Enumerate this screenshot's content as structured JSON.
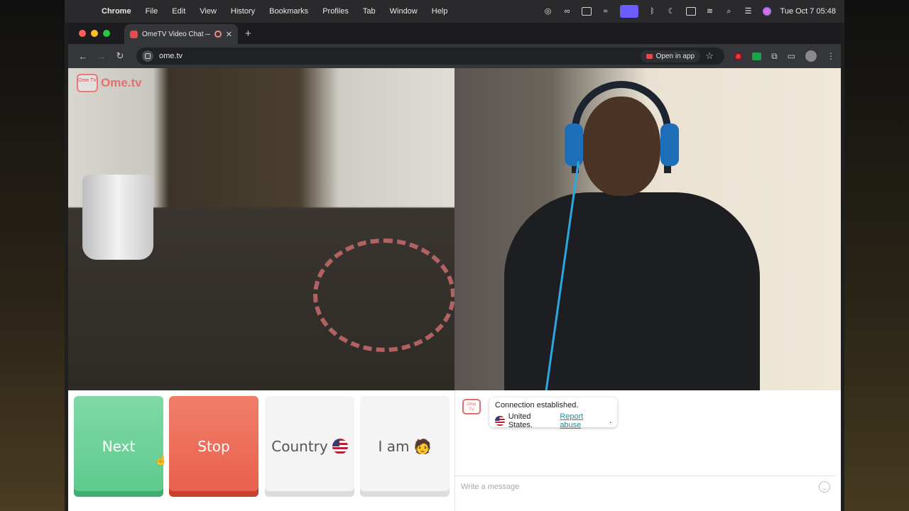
{
  "menubar": {
    "app": "Chrome",
    "items": [
      "File",
      "Edit",
      "View",
      "History",
      "Bookmarks",
      "Profiles",
      "Tab",
      "Window",
      "Help"
    ],
    "clock": "Tue Oct 7  05:48"
  },
  "browser": {
    "tab_title": "OmeTV Video Chat — Ome",
    "url": "ome.tv",
    "open_in_app": "Open in app"
  },
  "stage": {
    "logo_text": "Ome.tv",
    "logo_badge": "Ome TV"
  },
  "controls": {
    "next": "Next",
    "stop": "Stop",
    "country": "Country",
    "iam": "I am",
    "iam_emoji": "🧑",
    "colors": {
      "next": "#5dc98b",
      "stop": "#e85f4b"
    }
  },
  "chat": {
    "message_line1": "Connection established.",
    "country": "United States.",
    "report": "Report abuse",
    "placeholder": "Write a message"
  }
}
